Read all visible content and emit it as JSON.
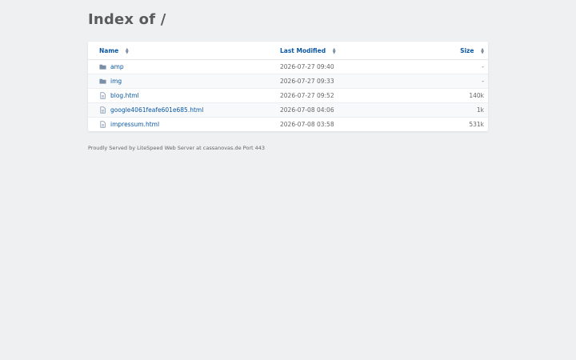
{
  "page": {
    "title": "Index of /",
    "footer": "Proudly Served by LiteSpeed Web Server at cassanovas.de Port 443"
  },
  "table": {
    "headers": {
      "name": "Name",
      "modified": "Last Modified",
      "size": "Size"
    },
    "rows": [
      {
        "name": "amp",
        "type": "folder-icon",
        "modified": "2026-07-27 09:40",
        "size": "-"
      },
      {
        "name": "img",
        "type": "folder-icon",
        "modified": "2026-07-27 09:33",
        "size": "-"
      },
      {
        "name": "blog.html",
        "type": "file-icon",
        "modified": "2026-07-27 09:52",
        "size": "140k"
      },
      {
        "name": "google4061feafe601e685.html",
        "type": "file-icon",
        "modified": "2026-07-08 04:06",
        "size": "1k"
      },
      {
        "name": "impressum.html",
        "type": "file-icon",
        "modified": "2026-07-08 03:58",
        "size": "531k"
      }
    ]
  },
  "colors": {
    "link": "#0a58a5",
    "background": "#eff0f2",
    "folder": "#7a8ea8"
  }
}
